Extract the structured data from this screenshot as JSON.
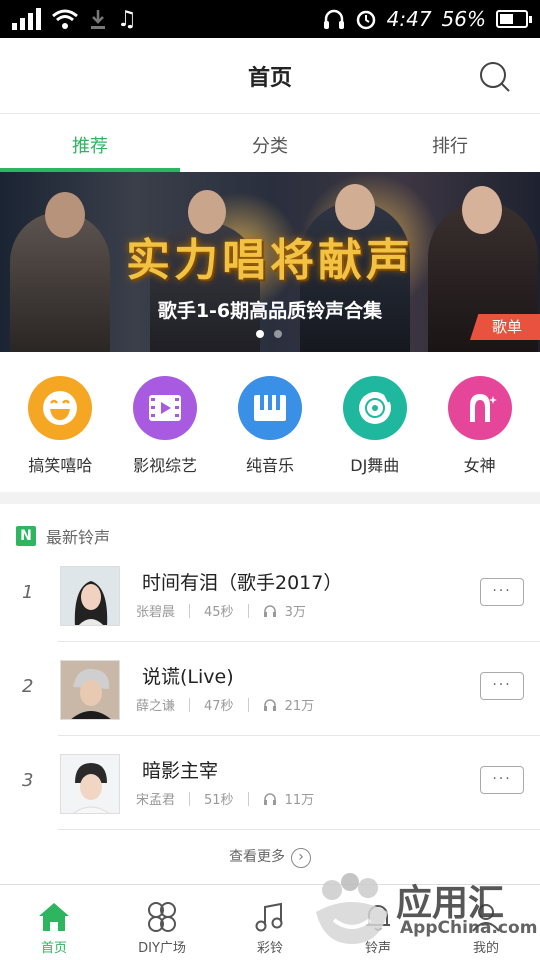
{
  "status": {
    "time": "4:47",
    "battery": "56%"
  },
  "header": {
    "title": "首页"
  },
  "tabs": [
    {
      "label": "推荐",
      "active": true
    },
    {
      "label": "分类",
      "active": false
    },
    {
      "label": "排行",
      "active": false
    }
  ],
  "banner": {
    "title": "实力唱将献声",
    "subtitle": "歌手1-6期高品质铃声合集",
    "badge": "歌单"
  },
  "categories": [
    {
      "label": "搞笑嘻哈",
      "color": "#f5a623",
      "icon": "laugh-icon"
    },
    {
      "label": "影视综艺",
      "color": "#a85be0",
      "icon": "film-icon"
    },
    {
      "label": "纯音乐",
      "color": "#3a8fe6",
      "icon": "piano-icon"
    },
    {
      "label": "DJ舞曲",
      "color": "#1fb89e",
      "icon": "disc-icon"
    },
    {
      "label": "女神",
      "color": "#e6469a",
      "icon": "goddess-icon"
    }
  ],
  "section": {
    "badge": "N",
    "title": "最新铃声"
  },
  "songs": [
    {
      "rank": "1",
      "name": "时间有泪（歌手2017）",
      "artist": "张碧晨",
      "duration": "45秒",
      "plays": "3万"
    },
    {
      "rank": "2",
      "name": "说谎(Live)",
      "artist": "薛之谦",
      "duration": "47秒",
      "plays": "21万"
    },
    {
      "rank": "3",
      "name": "暗影主宰",
      "artist": "宋孟君",
      "duration": "51秒",
      "plays": "11万"
    }
  ],
  "more_dots": "···",
  "see_more": "查看更多",
  "bottom_nav": [
    {
      "label": "首页",
      "active": true
    },
    {
      "label": "DIY广场",
      "active": false
    },
    {
      "label": "彩铃",
      "active": false
    },
    {
      "label": "铃声",
      "active": false
    },
    {
      "label": "我的",
      "active": false
    }
  ],
  "watermark": {
    "text": "应用汇",
    "sub": "AppChina.com"
  },
  "colors": {
    "accent": "#2db560",
    "badge_red": "#e9523f"
  }
}
